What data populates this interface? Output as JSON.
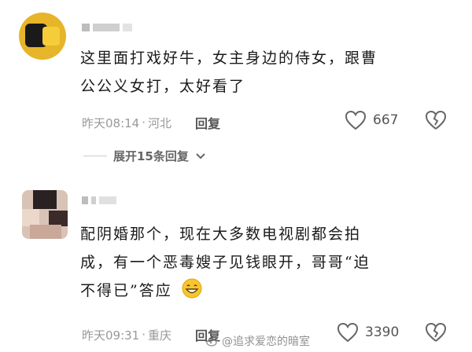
{
  "comments": [
    {
      "text_line1": "这里面打戏好牛，女主身边的侍女，跟曹",
      "text_line2": "公公义女打，太好看了",
      "time": "昨天08:14",
      "location": "河北",
      "reply_label": "回复",
      "likes": "667",
      "expand_label": "展开15条回复"
    },
    {
      "text_line1": "配阴婚那个，现在大多数电视剧都会拍",
      "text_line2": "成，有一个恶毒嫂子见钱眼开，哥哥“迫",
      "text_line3": "不得已”答应",
      "time": "昨天09:31",
      "location": "重庆",
      "reply_label": "回复",
      "likes": "3390"
    }
  ],
  "watermark": "@追求爱恋的暗室",
  "icons": {
    "like": "heart-outline-icon",
    "dislike": "broken-heart-icon",
    "expand": "chevron-down-icon",
    "emoji": "grinning-face-icon"
  }
}
